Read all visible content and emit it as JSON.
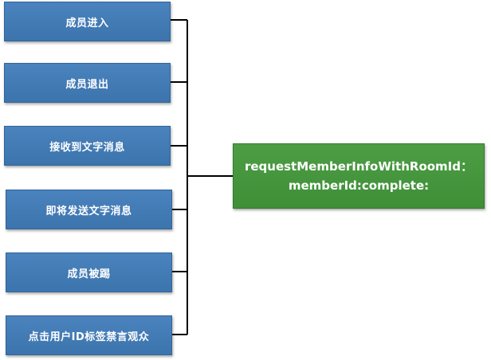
{
  "events": [
    "成员进入",
    "成员退出",
    "接收到文字消息",
    "即将发送文字消息",
    "成员被踢",
    "点击用户ID标签禁言观众"
  ],
  "target": {
    "line1": "requestMemberInfoWithRoomId：",
    "line2": "memberId:complete:"
  },
  "colors": {
    "event_box": "#3f78b2",
    "target_box": "#439339",
    "connector": "#000000"
  }
}
